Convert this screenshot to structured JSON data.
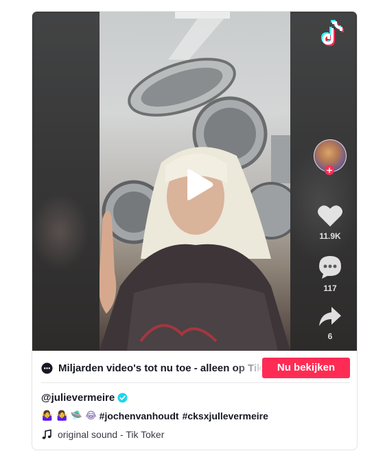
{
  "video": {
    "likes": "11.9K",
    "comments": "117",
    "shares": "6"
  },
  "banner": {
    "text": "Miljarden video's tot nu toe - alleen op TikTok",
    "button_label": "Nu bekijken"
  },
  "post": {
    "username": "@julievermeire",
    "caption": {
      "emojis": [
        "🤷‍♀️",
        "🤷‍♀️",
        "🛸",
        "😂"
      ],
      "hashtags": [
        "#jochenvanhoudt",
        "#cksxjullevermeire"
      ]
    },
    "sound": "original sound - Tik Toker"
  },
  "colors": {
    "brand_red": "#fe2c55",
    "verified_blue": "#20d5ec",
    "text_primary": "#161823"
  },
  "icons": {
    "play": "play-icon",
    "logo": "tiktok-logo-icon",
    "like": "heart-icon",
    "comment": "comment-icon",
    "share": "share-icon",
    "banner": "chat-bubble-icon",
    "verified": "verified-check-icon",
    "sound": "music-note-icon"
  }
}
